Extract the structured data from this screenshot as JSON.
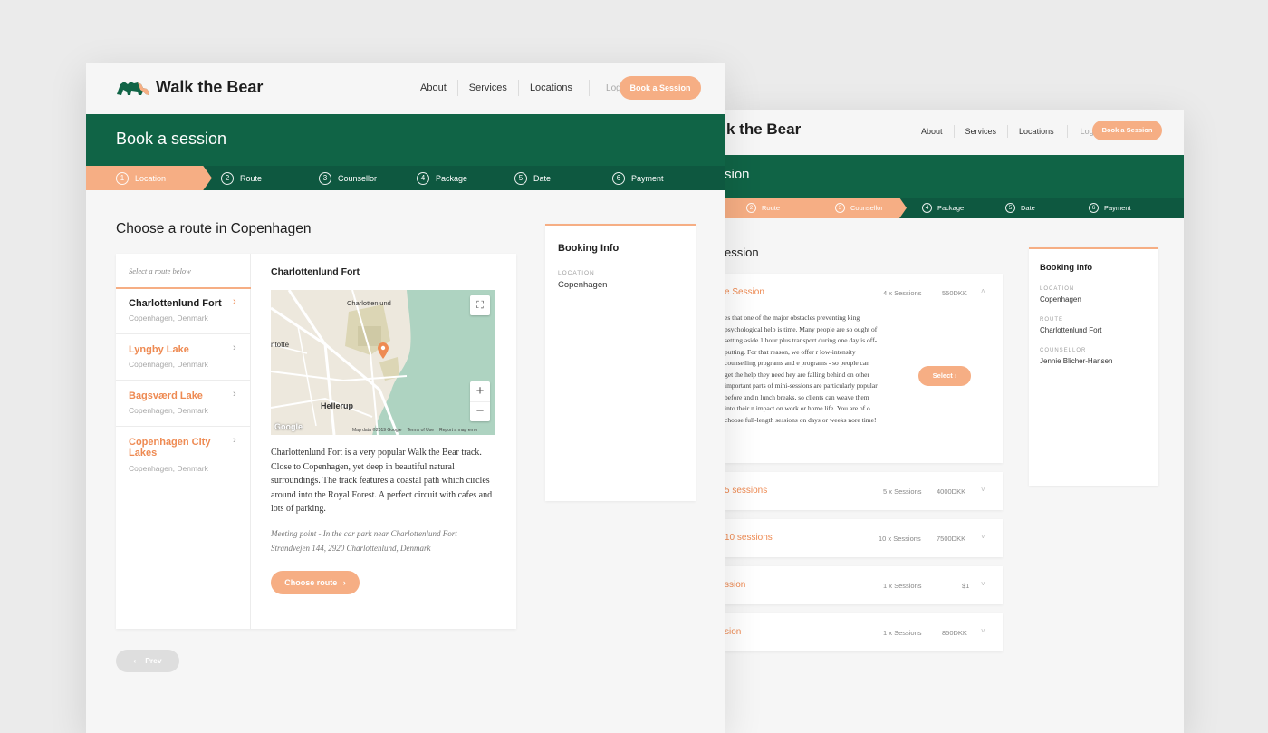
{
  "brand": {
    "name": "Walk the Bear",
    "name_partial": "k the Bear"
  },
  "nav": {
    "about": "About",
    "services": "Services",
    "locations": "Locations",
    "login": "Login",
    "cta": "Book a Session"
  },
  "front": {
    "banner_title": "Book a session",
    "steps": [
      {
        "num": "1",
        "label": "Location"
      },
      {
        "num": "2",
        "label": "Route"
      },
      {
        "num": "3",
        "label": "Counsellor"
      },
      {
        "num": "4",
        "label": "Package"
      },
      {
        "num": "5",
        "label": "Date"
      },
      {
        "num": "6",
        "label": "Payment"
      }
    ],
    "heading": "Choose a route in Copenhagen",
    "list_hint": "Select a route below",
    "routes": [
      {
        "name": "Charlottenlund Fort",
        "place": "Copenhagen, Denmark"
      },
      {
        "name": "Lyngby Lake",
        "place": "Copenhagen, Denmark"
      },
      {
        "name": "Bagsværd Lake",
        "place": "Copenhagen, Denmark"
      },
      {
        "name": "Copenhagen City Lakes",
        "place": "Copenhagen, Denmark"
      }
    ],
    "detail": {
      "title": "Charlottenlund Fort",
      "description": "Charlottenlund Fort is a very popular Walk the Bear track. Close to Copenhagen, yet deep in beautiful natural surroundings. The track features a coastal path which circles around into the Royal Forest. A perfect circuit with cafes and lots of parking.",
      "meeting": "Meeting point - In the car park near Charlottenlund Fort Strandvejen 144, 2920 Charlottenlund, Denmark",
      "button": "Choose route"
    },
    "map": {
      "label_charlottenlund": "Charlottenlund",
      "label_ntofte": "ntofte",
      "label_hellerup": "Hellerup",
      "google": "Google",
      "credits": "Map data ©2019 Google",
      "terms": "Terms of Use",
      "report": "Report a map error",
      "zoom_in": "+",
      "zoom_out": "−",
      "fullscreen": "⛶"
    },
    "booking": {
      "title": "Booking Info",
      "location_label": "Location",
      "location_value": "Copenhagen"
    },
    "prev": "Prev"
  },
  "back": {
    "banner_title": "sion",
    "steps": [
      {
        "num": "2",
        "label": "Route"
      },
      {
        "num": "3",
        "label": "Counsellor"
      },
      {
        "num": "4",
        "label": "Package"
      },
      {
        "num": "5",
        "label": "Date"
      },
      {
        "num": "6",
        "label": "Payment"
      }
    ],
    "heading": "ession",
    "packages": [
      {
        "name": "e Session",
        "count": "4 x Sessions",
        "price": "550DKK"
      },
      {
        "name": "5 sessions",
        "count": "5 x Sessions",
        "price": "4000DKK"
      },
      {
        "name": "10 sessions",
        "count": "10 x Sessions",
        "price": "7500DKK"
      },
      {
        "name": "ssion",
        "count": "1 x Sessions",
        "price": "$1"
      },
      {
        "name": "sion",
        "count": "1 x Sessions",
        "price": "850DKK"
      }
    ],
    "package_text": "es that one of the major obstacles preventing king psychological help is time. Many people are so ought of setting aside 1 hour plus transport during one day is off-putting. For that reason, we offer r low-intensity counselling programs and e programs - so people can get the help they need hey are falling behind on other important parts of mini-sessions are particularly popular before and n lunch breaks, so clients can weave them into their n impact on work or home life. You are of o choose full-length sessions on days or weeks nore time!",
    "select": "Select",
    "booking": {
      "title": "Booking Info",
      "location_label": "Location",
      "location_value": "Copenhagen",
      "route_label": "Route",
      "route_value": "Charlottenlund Fort",
      "counsellor_label": "Counsellor",
      "counsellor_value": "Jennie Blicher-Hansen"
    }
  },
  "colors": {
    "green": "#106446",
    "green_dark": "#0e5840",
    "orange": "#f6ae84",
    "orange_text": "#ee8a52"
  }
}
